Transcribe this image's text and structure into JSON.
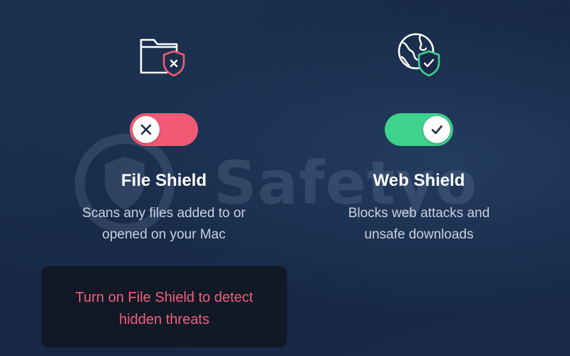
{
  "watermark": {
    "text": "Safetyo",
    "color": "#9fb3d1"
  },
  "shields": [
    {
      "icon": "folder-shield-x-icon",
      "toggle_state": "off",
      "toggle_color": "#f15a74",
      "knob_icon": "x-icon",
      "title": "File Shield",
      "description_lines": [
        "Scans any files added to or",
        "opened on your Mac"
      ]
    },
    {
      "icon": "globe-shield-check-icon",
      "toggle_state": "on",
      "toggle_color": "#3ed38c",
      "knob_icon": "check-icon",
      "title": "Web Shield",
      "description_lines": [
        "Blocks web attacks and",
        "unsafe downloads"
      ]
    }
  ],
  "warning": {
    "lines": [
      "Turn on File Shield to detect",
      "hidden threats"
    ],
    "color": "#f0607b"
  }
}
